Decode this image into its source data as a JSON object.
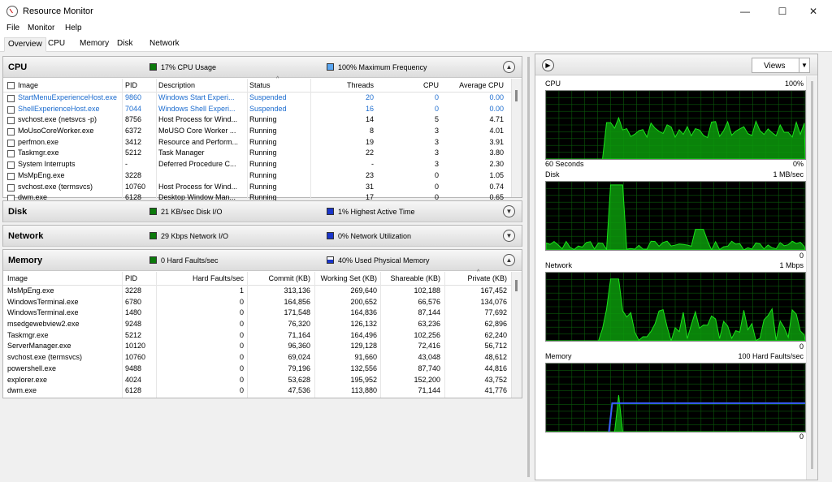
{
  "window": {
    "title": "Resource Monitor",
    "minimize": "—",
    "maximize": "☐",
    "close": "✕"
  },
  "menu": [
    "File",
    "Monitor",
    "Help"
  ],
  "tabs": [
    "Overview",
    "CPU",
    "Memory",
    "Disk",
    "Network"
  ],
  "colors": {
    "green": "#0b7a0b",
    "blue": "#1a35c9",
    "lightblue": "#5aa6f0",
    "graph_line": "#19e619",
    "graph_fill": "#0c9a0c",
    "grid": "#0a5a0a",
    "memory_line": "#3a60ff"
  },
  "cpu": {
    "title": "CPU",
    "usage": "17% CPU Usage",
    "frequency": "100% Maximum Frequency",
    "columns": [
      "Image",
      "PID",
      "Description",
      "Status",
      "Threads",
      "CPU",
      "Average CPU"
    ],
    "rows": [
      [
        "StartMenuExperienceHost.exe",
        "9860",
        "Windows Start Experi...",
        "Suspended",
        "20",
        "0",
        "0.00"
      ],
      [
        "ShellExperienceHost.exe",
        "7044",
        "Windows Shell Experi...",
        "Suspended",
        "16",
        "0",
        "0.00"
      ],
      [
        "svchost.exe (netsvcs -p)",
        "8756",
        "Host Process for Wind...",
        "Running",
        "14",
        "5",
        "4.71"
      ],
      [
        "MoUsoCoreWorker.exe",
        "6372",
        "MoUSO Core Worker ...",
        "Running",
        "8",
        "3",
        "4.01"
      ],
      [
        "perfmon.exe",
        "3412",
        "Resource and Perform...",
        "Running",
        "19",
        "3",
        "3.91"
      ],
      [
        "Taskmgr.exe",
        "5212",
        "Task Manager",
        "Running",
        "22",
        "3",
        "3.80"
      ],
      [
        "System Interrupts",
        "-",
        "Deferred Procedure C...",
        "Running",
        "-",
        "3",
        "2.30"
      ],
      [
        "MsMpEng.exe",
        "3228",
        "",
        "Running",
        "23",
        "0",
        "1.05"
      ],
      [
        "svchost.exe (termsvcs)",
        "10760",
        "Host Process for Wind...",
        "Running",
        "31",
        "0",
        "0.74"
      ],
      [
        "dwm.exe",
        "6128",
        "Desktop Window Man...",
        "Running",
        "17",
        "0",
        "0.65"
      ]
    ]
  },
  "disk": {
    "title": "Disk",
    "io": "21 KB/sec Disk I/O",
    "active": "1% Highest Active Time"
  },
  "network": {
    "title": "Network",
    "io": "29 Kbps Network I/O",
    "util": "0% Network Utilization"
  },
  "memory": {
    "title": "Memory",
    "faults": "0 Hard Faults/sec",
    "used": "40% Used Physical Memory",
    "columns": [
      "Image",
      "PID",
      "Hard Faults/sec",
      "Commit (KB)",
      "Working Set (KB)",
      "Shareable (KB)",
      "Private (KB)"
    ],
    "rows": [
      [
        "MsMpEng.exe",
        "3228",
        "1",
        "313,136",
        "269,640",
        "102,188",
        "167,452"
      ],
      [
        "WindowsTerminal.exe",
        "6780",
        "0",
        "164,856",
        "200,652",
        "66,576",
        "134,076"
      ],
      [
        "WindowsTerminal.exe",
        "1480",
        "0",
        "171,548",
        "164,836",
        "87,144",
        "77,692"
      ],
      [
        "msedgewebview2.exe",
        "9248",
        "0",
        "76,320",
        "126,132",
        "63,236",
        "62,896"
      ],
      [
        "Taskmgr.exe",
        "5212",
        "0",
        "71,164",
        "164,496",
        "102,256",
        "62,240"
      ],
      [
        "ServerManager.exe",
        "10120",
        "0",
        "96,360",
        "129,128",
        "72,416",
        "56,712"
      ],
      [
        "svchost.exe (termsvcs)",
        "10760",
        "0",
        "69,024",
        "91,660",
        "43,048",
        "48,612"
      ],
      [
        "powershell.exe",
        "9488",
        "0",
        "79,196",
        "132,556",
        "87,740",
        "44,816"
      ],
      [
        "explorer.exe",
        "4024",
        "0",
        "53,628",
        "195,952",
        "152,200",
        "43,752"
      ],
      [
        "dwm.exe",
        "6128",
        "0",
        "47,536",
        "113,880",
        "71,144",
        "41,776"
      ]
    ]
  },
  "right": {
    "views": "Views",
    "graphs": [
      {
        "name": "CPU",
        "max": "100%",
        "min": "0%",
        "bottom_left": "60 Seconds"
      },
      {
        "name": "Disk",
        "max": "1 MB/sec",
        "min": "0",
        "bottom_left": ""
      },
      {
        "name": "Network",
        "max": "1 Mbps",
        "min": "0",
        "bottom_left": ""
      },
      {
        "name": "Memory",
        "max": "100 Hard Faults/sec",
        "min": "0",
        "bottom_left": ""
      }
    ]
  }
}
